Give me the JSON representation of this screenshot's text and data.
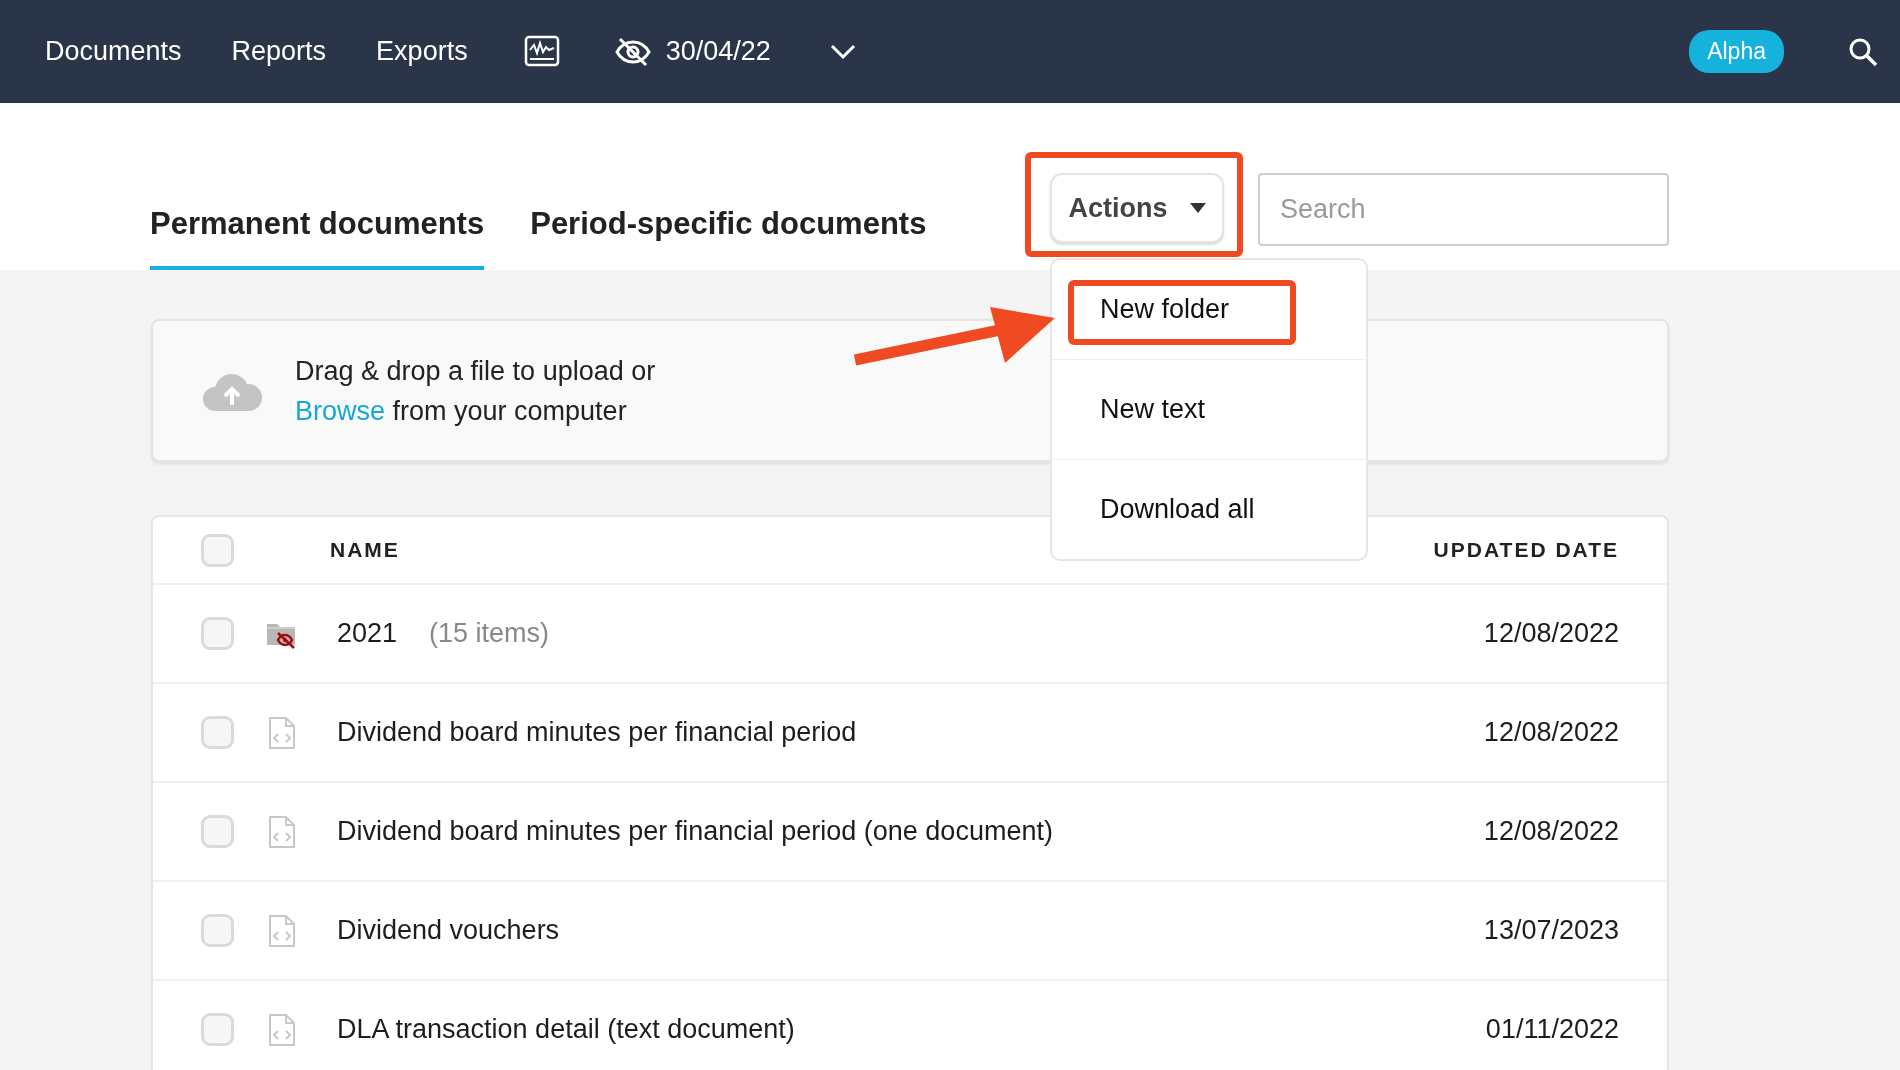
{
  "nav": {
    "items": [
      {
        "label": "Documents"
      },
      {
        "label": "Reports"
      },
      {
        "label": "Exports"
      }
    ],
    "date": "30/04/22",
    "badge": "Alpha"
  },
  "tabs": [
    {
      "label": "Permanent documents",
      "selected": true
    },
    {
      "label": "Period-specific documents",
      "selected": false
    }
  ],
  "actions": {
    "label": "Actions",
    "highlighted": true,
    "menu": [
      {
        "label": "New folder",
        "highlighted": true,
        "arrow": true
      },
      {
        "label": "New text",
        "highlighted": false,
        "arrow": false
      },
      {
        "label": "Download all",
        "highlighted": false,
        "arrow": false
      }
    ]
  },
  "search": {
    "placeholder": "Search"
  },
  "upload": {
    "text": "Drag & drop a file to upload or",
    "link": "Browse",
    "text_after": "from your computer"
  },
  "table": {
    "select_all_checked": false,
    "columns": [
      "NAME",
      "UPDATED DATE"
    ],
    "rows": [
      {
        "kind": "folder",
        "name": "2021",
        "count": "(15 items)",
        "updated": "12/08/2022",
        "checked": false
      },
      {
        "kind": "document",
        "name": "Dividend board minutes per financial period",
        "updated": "12/08/2022",
        "checked": false
      },
      {
        "kind": "document",
        "name": "Dividend board minutes per financial period (one document)",
        "updated": "12/08/2022",
        "checked": false
      },
      {
        "kind": "document",
        "name": "Dividend vouchers",
        "updated": "13/07/2023",
        "checked": false
      },
      {
        "kind": "document",
        "name": "DLA transaction detail (text document)",
        "updated": "01/11/2022",
        "checked": false
      }
    ]
  }
}
